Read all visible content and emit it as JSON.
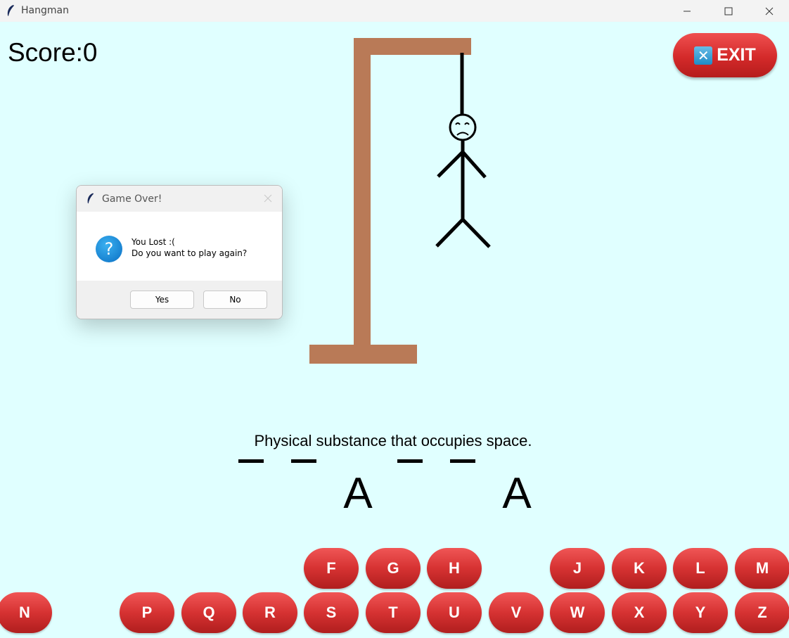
{
  "window": {
    "title": "Hangman"
  },
  "score_label": "Score:0",
  "exit_button": {
    "label": "EXIT",
    "icon_glyph": "✕"
  },
  "hint": "Physical substance that occupies space.",
  "word_slots": [
    "",
    "",
    "A",
    "",
    "",
    "A"
  ],
  "keyboard": {
    "row1": [
      "F",
      "G",
      "H",
      "J",
      "K",
      "L",
      "M"
    ],
    "row2": [
      "N",
      "P",
      "Q",
      "R",
      "S",
      "T",
      "U",
      "V",
      "W",
      "X",
      "Y",
      "Z"
    ]
  },
  "dialog": {
    "title": "Game Over!",
    "line1": "You Lost :(",
    "line2": "Do you want to play again?",
    "icon_glyph": "?",
    "yes_label": "Yes",
    "no_label": "No"
  },
  "colors": {
    "background": "#e0ffff",
    "gallows": "#b97a57",
    "key_red": "#d63232"
  }
}
